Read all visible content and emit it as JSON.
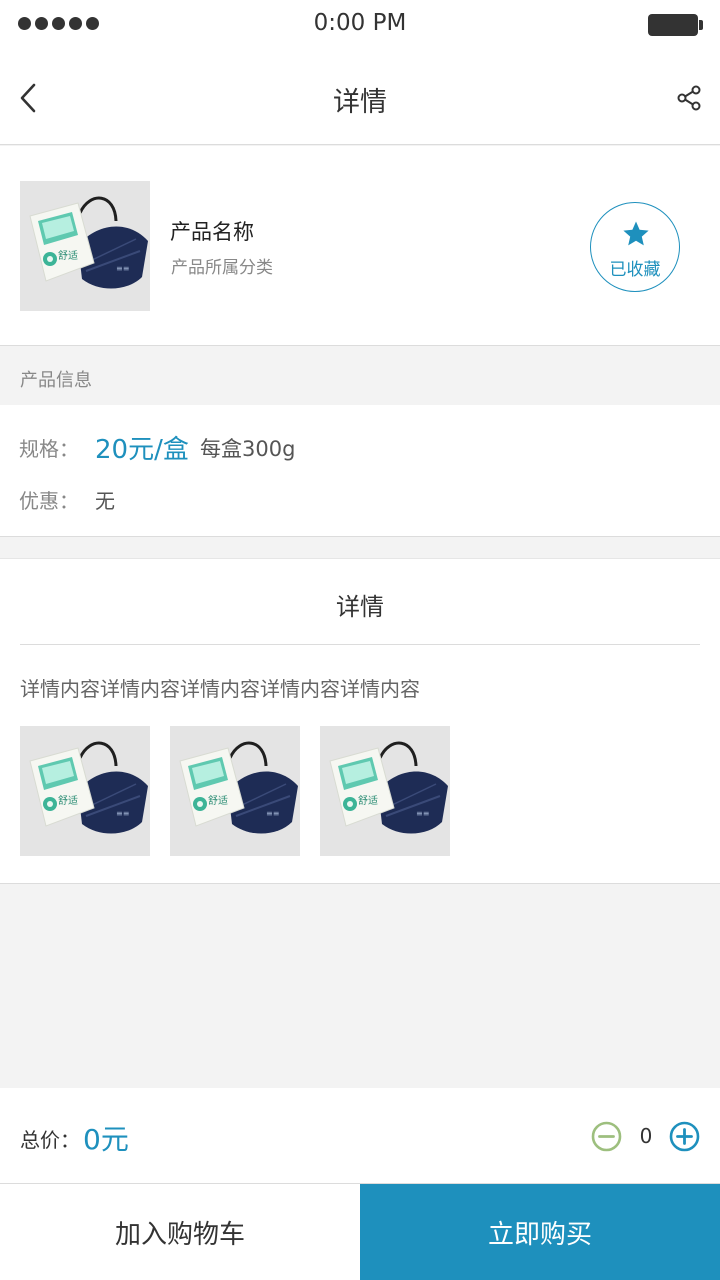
{
  "status_bar": {
    "time": "0:00 PM"
  },
  "nav": {
    "title": "详情"
  },
  "product": {
    "name": "产品名称",
    "category": "产品所属分类",
    "favorite_label": "已收藏"
  },
  "product_info": {
    "section_title": "产品信息",
    "spec_label": "规格：",
    "spec_price": "20元/盒",
    "spec_detail": "每盒300g",
    "promo_label": "优惠：",
    "promo_value": "无"
  },
  "detail": {
    "title": "详情",
    "content": "详情内容详情内容详情内容详情内容详情内容",
    "image_count": 3
  },
  "footer": {
    "total_label": "总价：",
    "total_value": "0元",
    "quantity": "0",
    "add_to_cart_label": "加入购物车",
    "buy_now_label": "立即购买"
  },
  "colors": {
    "accent": "#1e90bd",
    "minus_button": "#9dbf7e"
  },
  "icons": {
    "back": "chevron-left-icon",
    "share": "share-icon",
    "favorite": "star-icon",
    "minus": "minus-circle-icon",
    "plus": "plus-circle-icon"
  }
}
